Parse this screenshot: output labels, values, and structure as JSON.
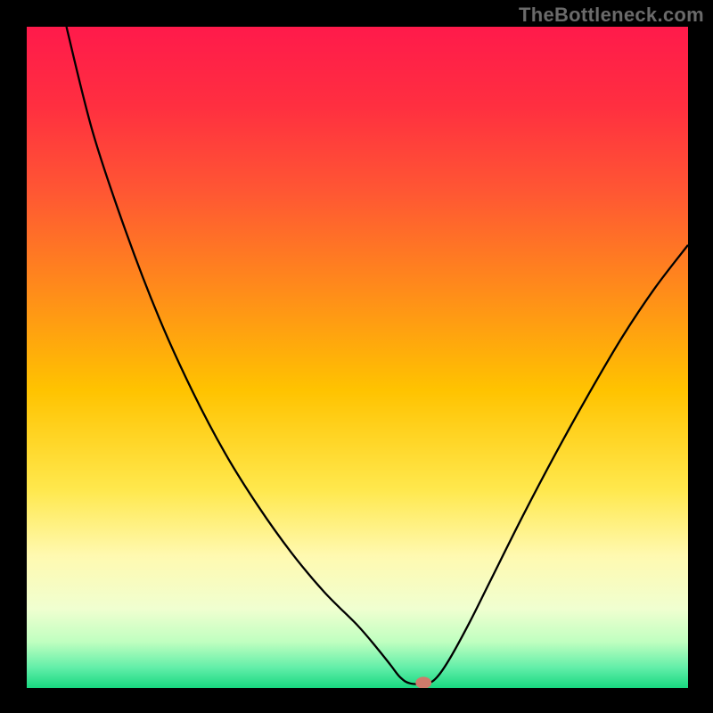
{
  "watermark": "TheBottleneck.com",
  "chart_data": {
    "type": "line",
    "title": "",
    "xlabel": "",
    "ylabel": "",
    "xlim": [
      0,
      100
    ],
    "ylim": [
      0,
      100
    ],
    "background_gradient": {
      "stops": [
        {
          "offset": 0.0,
          "color": "#ff1a4b"
        },
        {
          "offset": 0.12,
          "color": "#ff2f40"
        },
        {
          "offset": 0.25,
          "color": "#ff5733"
        },
        {
          "offset": 0.4,
          "color": "#ff8c1a"
        },
        {
          "offset": 0.55,
          "color": "#ffc300"
        },
        {
          "offset": 0.7,
          "color": "#ffe84d"
        },
        {
          "offset": 0.8,
          "color": "#fff9b0"
        },
        {
          "offset": 0.88,
          "color": "#f0ffd0"
        },
        {
          "offset": 0.93,
          "color": "#c0ffc0"
        },
        {
          "offset": 0.97,
          "color": "#60eea8"
        },
        {
          "offset": 1.0,
          "color": "#18d880"
        }
      ]
    },
    "series": [
      {
        "name": "bottleneck-curve",
        "color": "#000000",
        "width": 2.3,
        "points": [
          {
            "x": 6.0,
            "y": 100.0
          },
          {
            "x": 10.0,
            "y": 84.0
          },
          {
            "x": 15.0,
            "y": 69.0
          },
          {
            "x": 20.0,
            "y": 56.0
          },
          {
            "x": 25.0,
            "y": 45.0
          },
          {
            "x": 30.0,
            "y": 35.5
          },
          {
            "x": 35.0,
            "y": 27.5
          },
          {
            "x": 40.0,
            "y": 20.5
          },
          {
            "x": 45.0,
            "y": 14.5
          },
          {
            "x": 50.0,
            "y": 9.5
          },
          {
            "x": 53.0,
            "y": 6.0
          },
          {
            "x": 55.0,
            "y": 3.5
          },
          {
            "x": 56.5,
            "y": 1.6
          },
          {
            "x": 58.0,
            "y": 0.7
          },
          {
            "x": 60.5,
            "y": 0.7
          },
          {
            "x": 62.0,
            "y": 1.6
          },
          {
            "x": 64.0,
            "y": 4.5
          },
          {
            "x": 67.0,
            "y": 10.0
          },
          {
            "x": 70.0,
            "y": 16.0
          },
          {
            "x": 75.0,
            "y": 26.0
          },
          {
            "x": 80.0,
            "y": 35.5
          },
          {
            "x": 85.0,
            "y": 44.5
          },
          {
            "x": 90.0,
            "y": 53.0
          },
          {
            "x": 95.0,
            "y": 60.5
          },
          {
            "x": 100.0,
            "y": 67.0
          }
        ]
      }
    ],
    "marker": {
      "name": "optimal-point",
      "x": 60.0,
      "y": 0.8,
      "rx": 1.2,
      "ry": 0.9,
      "color": "#cf7a6b"
    }
  }
}
